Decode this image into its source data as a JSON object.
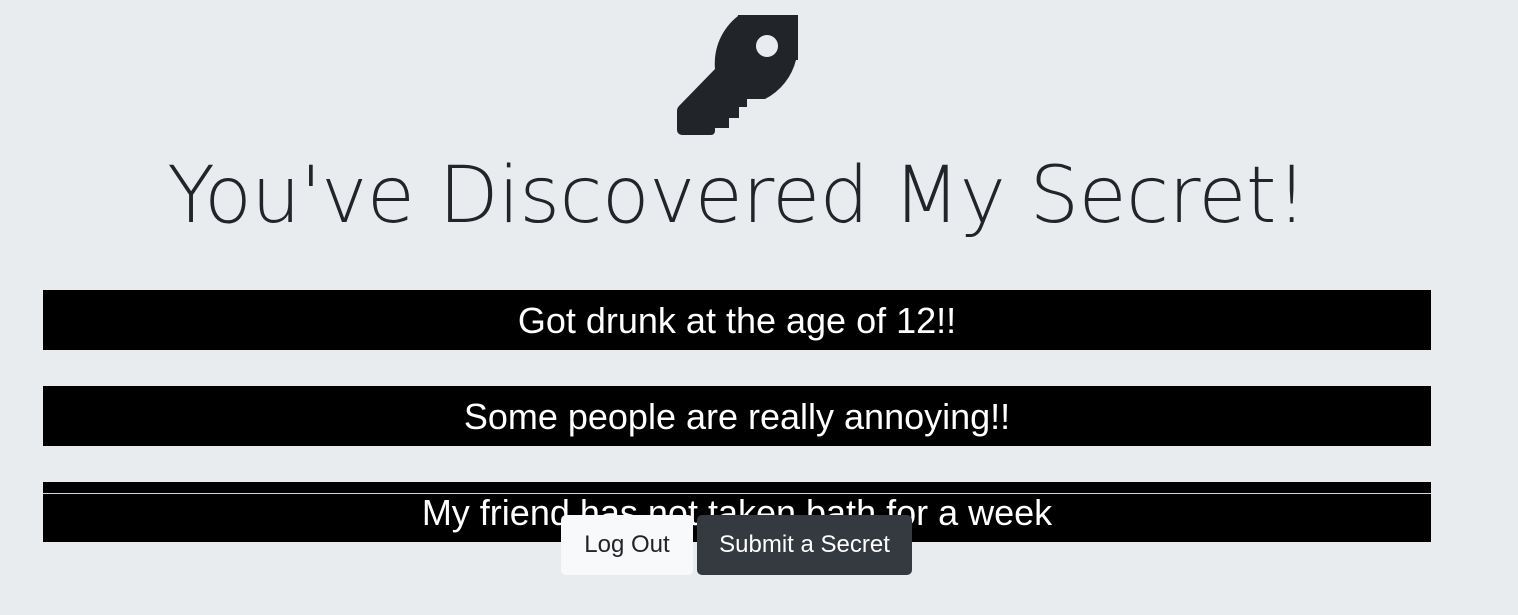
{
  "hero": {
    "icon": "key-icon",
    "title": "You've Discovered My Secret!"
  },
  "secrets": [
    {
      "text": "Got drunk at the age of 12!!"
    },
    {
      "text": "Some people are really annoying!!"
    },
    {
      "text": "My friend has not taken bath for a week"
    }
  ],
  "actions": {
    "logout_label": "Log Out",
    "submit_label": "Submit a Secret"
  },
  "colors": {
    "background": "#e9ecef",
    "secret_bar": "#000000",
    "secret_text": "#ffffff",
    "title_text": "#212529",
    "button_light": "#f8f9fa",
    "button_dark": "#343a40"
  }
}
